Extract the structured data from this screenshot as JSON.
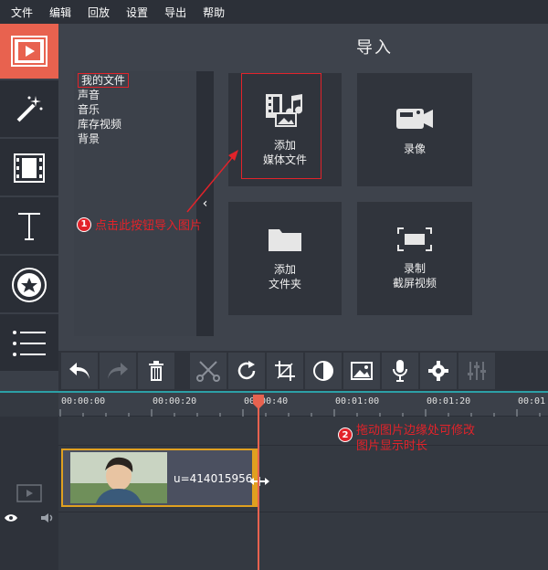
{
  "menu": [
    "文件",
    "编辑",
    "回放",
    "设置",
    "导出",
    "帮助"
  ],
  "panel": {
    "title": "导入"
  },
  "file_list": [
    "我的文件",
    "声音",
    "音乐",
    "库存视频",
    "背景"
  ],
  "tiles": {
    "add_media_1": "添加",
    "add_media_2": "媒体文件",
    "record_video": "录像",
    "add_folder_1": "添加",
    "add_folder_2": "文件夹",
    "screen_rec_1": "录制",
    "screen_rec_2": "截屏视频"
  },
  "annotations": {
    "step1_num": "1",
    "step1_text": "点击此按钮导入图片",
    "step2_num": "2",
    "step2_line1": "拖动图片边缘处可修改",
    "step2_line2": "图片显示时长"
  },
  "timeline": {
    "ticks": [
      "00:00:00",
      "00:00:20",
      "00:00:40",
      "00:01:00",
      "00:01:20",
      "00:01"
    ],
    "clip_label": "u=414015956"
  },
  "colors": {
    "accent": "#e8624f",
    "annotation_red": "#e2232a",
    "clip_border": "#e0a020"
  }
}
